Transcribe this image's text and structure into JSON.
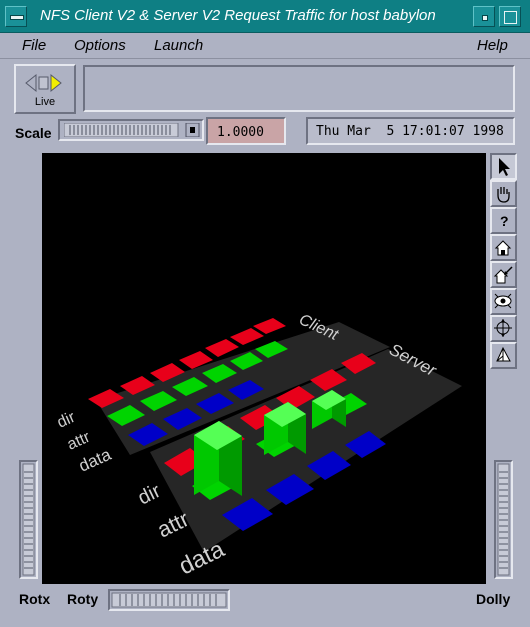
{
  "window": {
    "title": "NFS Client V2 & Server V2 Request Traffic for host babylon"
  },
  "menubar": {
    "file": "File",
    "options": "Options",
    "launch": "Launch",
    "help": "Help"
  },
  "toolbar": {
    "live_label": "Live",
    "message": "",
    "scale_label": "Scale",
    "scale_value": "1.0000",
    "datetime": "Thu Mar  5 17:01:07 1998"
  },
  "viewer": {
    "client_label": "Client",
    "server_label": "Server",
    "client_rows": [
      "dir",
      "attr",
      "data"
    ],
    "server_rows": [
      "dir",
      "attr",
      "data"
    ],
    "row_colors": {
      "dir": "#e8001a",
      "attr": "#00d400",
      "data": "#0000c8"
    }
  },
  "right_tools": [
    "pointer-icon",
    "hand-icon",
    "help-icon",
    "home-icon",
    "set-home-icon",
    "view-all-icon",
    "seek-icon",
    "perspective-icon"
  ],
  "help_glyph": "?",
  "bottom": {
    "rotx": "Rotx",
    "roty": "Roty",
    "dolly": "Dolly"
  }
}
